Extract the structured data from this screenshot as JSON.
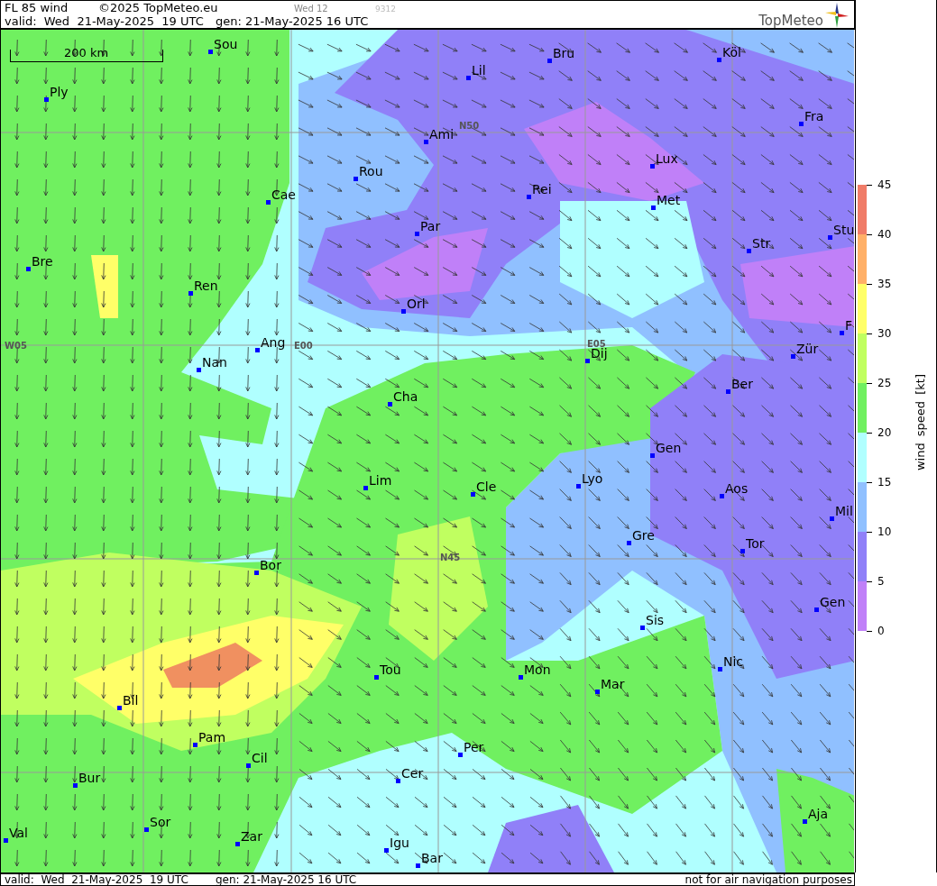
{
  "header": {
    "title": "FL 85 wind",
    "copyright": "©2025 TopMeteo.eu",
    "day": "Wed 12",
    "code": "9312",
    "valid": "valid:  Wed  21-May-2025  19 UTC",
    "generated": "gen: 21-May-2025 16 UTC",
    "logo": "TopMeteo"
  },
  "map": {
    "scale": "200 km",
    "grid_labels": [
      "N50",
      "W05",
      "E00",
      "E05",
      "N45"
    ],
    "cities": [
      "Sou",
      "Lil",
      "Bru",
      "Köl",
      "Ply",
      "Ami",
      "Fra",
      "Rou",
      "Lux",
      "Cae",
      "Rei",
      "Met",
      "Par",
      "Stu",
      "Str",
      "Bre",
      "Ren",
      "Orl",
      "F",
      "Ang",
      "Dij",
      "Zür",
      "Nan",
      "Ber",
      "Cha",
      "Gen",
      "Lim",
      "Cle",
      "Lyo",
      "Aos",
      "Mil",
      "Gre",
      "Tor",
      "Bor",
      "Gen",
      "Sis",
      "Nic",
      "Mon",
      "Tou",
      "Mar",
      "Bil",
      "Pam",
      "Per",
      "Cil",
      "Bur",
      "Cer",
      "Sor",
      "Aja",
      "Val",
      "Zar",
      "Igu",
      "Bar"
    ]
  },
  "legend": {
    "title": "wind speed [kt]",
    "ticks": [
      "45",
      "40",
      "35",
      "30",
      "25",
      "20",
      "15",
      "10",
      "5",
      "0"
    ],
    "bands": [
      {
        "color": "#f07c68"
      },
      {
        "color": "#ffb068"
      },
      {
        "color": "#ffff68"
      },
      {
        "color": "#c0ff60"
      },
      {
        "color": "#70f060"
      },
      {
        "color": "#b0ffff"
      },
      {
        "color": "#90c0ff"
      },
      {
        "color": "#9080f8"
      },
      {
        "color": "#c080f8"
      }
    ]
  },
  "footer": {
    "valid": "valid:  Wed  21-May-2025  19 UTC",
    "generated": "gen: 21-May-2025 16 UTC",
    "disclaimer": "not for air navigation purposes"
  }
}
